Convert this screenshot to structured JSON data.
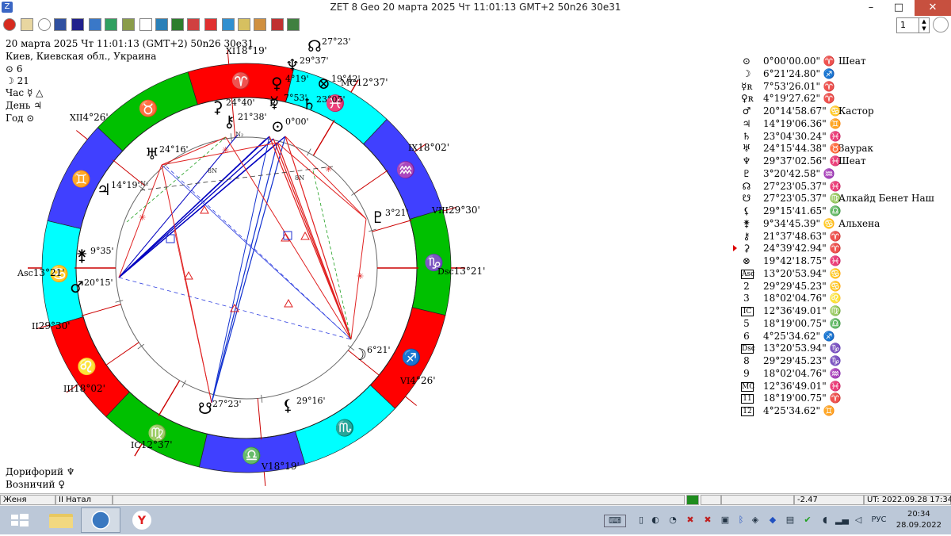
{
  "window": {
    "title": "ZET 8 Geo    20 марта 2025   Чт   11:01:13 GMT+2 50n26  30e31",
    "minimize": "–",
    "maximize": "□",
    "close": "✕"
  },
  "toolbar": {
    "spin_value": "1"
  },
  "header": {
    "date_line": "20 марта 2025   Чт   11:01:13 (GMT+2) 50n26  30e31",
    "place": "Киев, Киевская обл., Украина",
    "line1": "⊙  6",
    "line2": "☽  21",
    "hour": "Час ☿ △",
    "day": "День ♃",
    "year": "Год ⊙"
  },
  "footer_notes": {
    "doriphory": "Дорифорий  ♆",
    "vozn": "Возничий  ♀"
  },
  "chart": {
    "signs": [
      "♈",
      "♉",
      "♊",
      "♋",
      "♌",
      "♍",
      "♎",
      "♏",
      "♐",
      "♑",
      "♒",
      "♓"
    ],
    "house_labels": [
      {
        "name": "XII",
        "deg": "4°26'"
      },
      {
        "name": "XI",
        "deg": "18°19'"
      },
      {
        "name": "MC",
        "deg": "12°37'"
      },
      {
        "name": "IX",
        "deg": "18°02'"
      },
      {
        "name": "VIII",
        "deg": "29°30'"
      },
      {
        "name": "Dsc",
        "deg": "13°21'"
      },
      {
        "name": "VI",
        "deg": "4°26'"
      },
      {
        "name": "V",
        "deg": "18°19'"
      },
      {
        "name": "IC",
        "deg": "12°37'"
      },
      {
        "name": "III",
        "deg": "18°02'"
      },
      {
        "name": "II",
        "deg": "29°30'"
      },
      {
        "name": "Asc",
        "deg": "13°21'"
      }
    ],
    "planet_labels": [
      {
        "glyph": "☊",
        "deg": "27°23'"
      },
      {
        "glyph": "♆",
        "deg": "29°37'"
      },
      {
        "glyph": "♀",
        "deg": "4°19'"
      },
      {
        "glyph": "☿",
        "deg": "7°53'"
      },
      {
        "glyph": "⊗",
        "deg": "19°42'"
      },
      {
        "glyph": "♄",
        "deg": "23°05'"
      },
      {
        "glyph": "⊙",
        "deg": "0°00'"
      },
      {
        "glyph": "⚷",
        "deg": "21°38'"
      },
      {
        "glyph": "♅",
        "deg": "24°16'"
      },
      {
        "glyph": "♃",
        "deg": "14°19'"
      },
      {
        "glyph": "⚵",
        "deg": "9°35'"
      },
      {
        "glyph": "♂",
        "deg": "20°15'"
      },
      {
        "glyph": "♇",
        "deg": "3°21'"
      },
      {
        "glyph": "☽",
        "deg": "6°21'"
      },
      {
        "glyph": "☋",
        "deg": "27°23'"
      },
      {
        "glyph": "⚸",
        "deg": "29°16'"
      },
      {
        "glyph": "⚳",
        "deg": "24°40'"
      }
    ],
    "retro": "R",
    "node_marks": [
      "8N",
      "8N",
      "N₂",
      "N₂"
    ]
  },
  "positions": [
    {
      "sym": "⊙",
      "pos": "0°00'00.00\" ♈",
      "star": "Шеат"
    },
    {
      "sym": "☽",
      "pos": "6°21'24.80\" ♐",
      "star": ""
    },
    {
      "sym": "☿ʀ",
      "pos": "7°53'26.01\" ♈",
      "star": ""
    },
    {
      "sym": "♀ʀ",
      "pos": "4°19'27.62\" ♈",
      "star": ""
    },
    {
      "sym": "♂",
      "pos": "20°14'58.67\" ♋",
      "star": "Кастор"
    },
    {
      "sym": "♃",
      "pos": "14°19'06.36\" ♊",
      "star": ""
    },
    {
      "sym": "♄",
      "pos": "23°04'30.24\" ♓",
      "star": ""
    },
    {
      "sym": "♅",
      "pos": "24°15'44.38\" ♉",
      "star": "Заурак"
    },
    {
      "sym": "♆",
      "pos": "29°37'02.56\" ♓",
      "star": "Шеат"
    },
    {
      "sym": "♇",
      "pos": "3°20'42.58\" ♒",
      "star": ""
    },
    {
      "sym": "☊",
      "pos": "27°23'05.37\" ♓",
      "star": ""
    },
    {
      "sym": "☋",
      "pos": "27°23'05.37\" ♍",
      "star": "Алкайд Бенет Наш"
    },
    {
      "sym": "⚸",
      "pos": "29°15'41.65\" ♎",
      "star": ""
    },
    {
      "sym": "⚵",
      "pos": "9°34'45.39\" ♋",
      "star": "Альхена"
    },
    {
      "sym": "⚷",
      "pos": "21°37'48.63\" ♈",
      "star": ""
    },
    {
      "sym": "⚳",
      "pos": "24°39'42.94\" ♈",
      "star": ""
    },
    {
      "sym": "⊗",
      "pos": "19°42'18.75\" ♓",
      "star": ""
    },
    {
      "sym": "Asc",
      "pos": "13°20'53.94\" ♋",
      "star": ""
    },
    {
      "sym": "2",
      "pos": "29°29'45.23\" ♋",
      "star": ""
    },
    {
      "sym": "3",
      "pos": "18°02'04.76\" ♌",
      "star": ""
    },
    {
      "sym": "IC",
      "pos": "12°36'49.01\" ♍",
      "star": ""
    },
    {
      "sym": "5",
      "pos": "18°19'00.75\" ♎",
      "star": ""
    },
    {
      "sym": "6",
      "pos": "4°25'34.62\" ♐",
      "star": ""
    },
    {
      "sym": "Dsc",
      "pos": "13°20'53.94\" ♑",
      "star": ""
    },
    {
      "sym": "8",
      "pos": "29°29'45.23\" ♑",
      "star": ""
    },
    {
      "sym": "9",
      "pos": "18°02'04.76\" ♒",
      "star": ""
    },
    {
      "sym": "MC",
      "pos": "12°36'49.01\" ♓",
      "star": ""
    },
    {
      "sym": "11",
      "pos": "18°19'00.75\" ♈",
      "star": ""
    },
    {
      "sym": "12",
      "pos": "4°25'34.62\" ♊",
      "star": ""
    }
  ],
  "statusbar": {
    "name": "Женя",
    "mode": "II Натал",
    "value": "-2.47",
    "ut": "UT: 2022.09.28 17:34:13"
  },
  "taskbar": {
    "lang": "РУС",
    "time": "20:34",
    "date": "28.09.2022"
  },
  "colors": {
    "fire": "#ff0000",
    "earth": "#00c000",
    "air": "#4040ff",
    "water": "#00ffff",
    "taskbar": "#bcc8d8"
  }
}
